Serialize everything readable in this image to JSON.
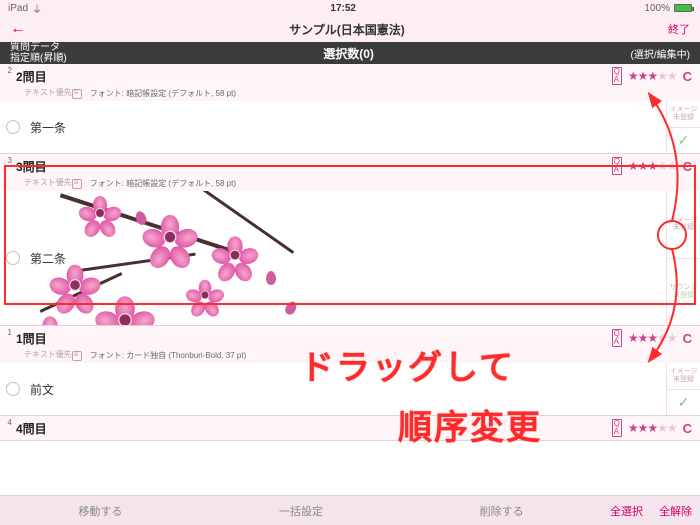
{
  "status": {
    "device": "iPad",
    "time": "17:52",
    "battery": "100%"
  },
  "nav": {
    "title": "サンプル(日本国憲法)",
    "end": "終了"
  },
  "selbar": {
    "left1": "質問データ",
    "left2": "指定順(昇順)",
    "mid": "選択数(0)",
    "right": "(選択/編集中)"
  },
  "font_default": "フォント: 暗記帳設定 (デフォルト, 58 pt)",
  "font_card": "フォント: カード独自 (Thonburi-Bold, 37 pt)",
  "priority": "テキスト優先",
  "side": {
    "img": "イメージ\n未登録",
    "snd": "サウンド\n未登録"
  },
  "items": [
    {
      "num": "2",
      "title": "2問目",
      "answer": "第一条",
      "stars": 3,
      "grade": "C",
      "font": "default"
    },
    {
      "num": "3",
      "title": "3問目",
      "answer": "第二条",
      "stars": 3,
      "grade": "C",
      "font": "default"
    },
    {
      "num": "1",
      "title": "1問目",
      "answer": "前文",
      "stars": 3,
      "grade": "C",
      "font": "card"
    },
    {
      "num": "4",
      "title": "4問目",
      "answer": "",
      "stars": 3,
      "grade": "C",
      "font": "default"
    }
  ],
  "toolbar": {
    "move": "移動する",
    "batch": "一括設定",
    "delete": "削除する",
    "selAll": "全選択",
    "deselAll": "全解除"
  },
  "annot": {
    "l1": "ドラッグして",
    "l2": "順序変更"
  }
}
